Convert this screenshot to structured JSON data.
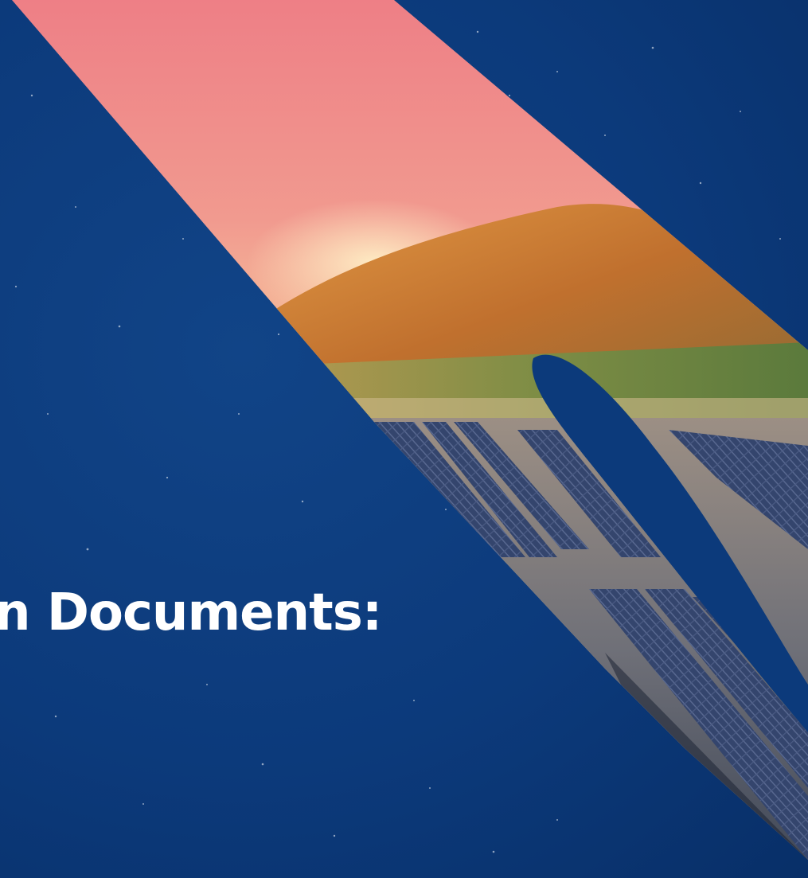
{
  "headline": {
    "text": "n Documents:"
  },
  "scene": {
    "background_color": "#0c3a7b",
    "sky_top_color": "#f08a86",
    "sky_horizon_color": "#f7b267",
    "hill_color": "#c9742f",
    "field_color": "#6f8a3a",
    "water_color": "#7d7f86",
    "panel_color": "#2f3f66"
  }
}
